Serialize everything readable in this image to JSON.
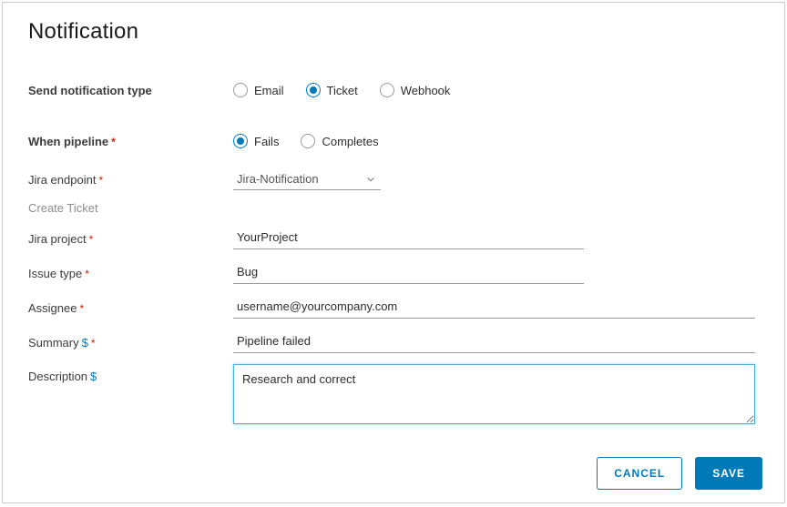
{
  "title": "Notification",
  "labels": {
    "send_type": "Send notification type",
    "when_pipeline": "When pipeline",
    "jira_endpoint": "Jira endpoint",
    "create_ticket": "Create Ticket",
    "jira_project": "Jira project",
    "issue_type": "Issue type",
    "assignee": "Assignee",
    "summary": "Summary",
    "description": "Description"
  },
  "notification_types": {
    "email": "Email",
    "ticket": "Ticket",
    "webhook": "Webhook",
    "selected": "ticket"
  },
  "pipeline_events": {
    "fails": "Fails",
    "completes": "Completes",
    "selected": "fails"
  },
  "fields": {
    "jira_endpoint": "Jira-Notification",
    "jira_project": "YourProject",
    "issue_type": "Bug",
    "assignee": "username@yourcompany.com",
    "summary": "Pipeline failed",
    "description": "Research and correct"
  },
  "buttons": {
    "cancel": "CANCEL",
    "save": "SAVE"
  },
  "symbols": {
    "required": "*",
    "var": "$"
  }
}
